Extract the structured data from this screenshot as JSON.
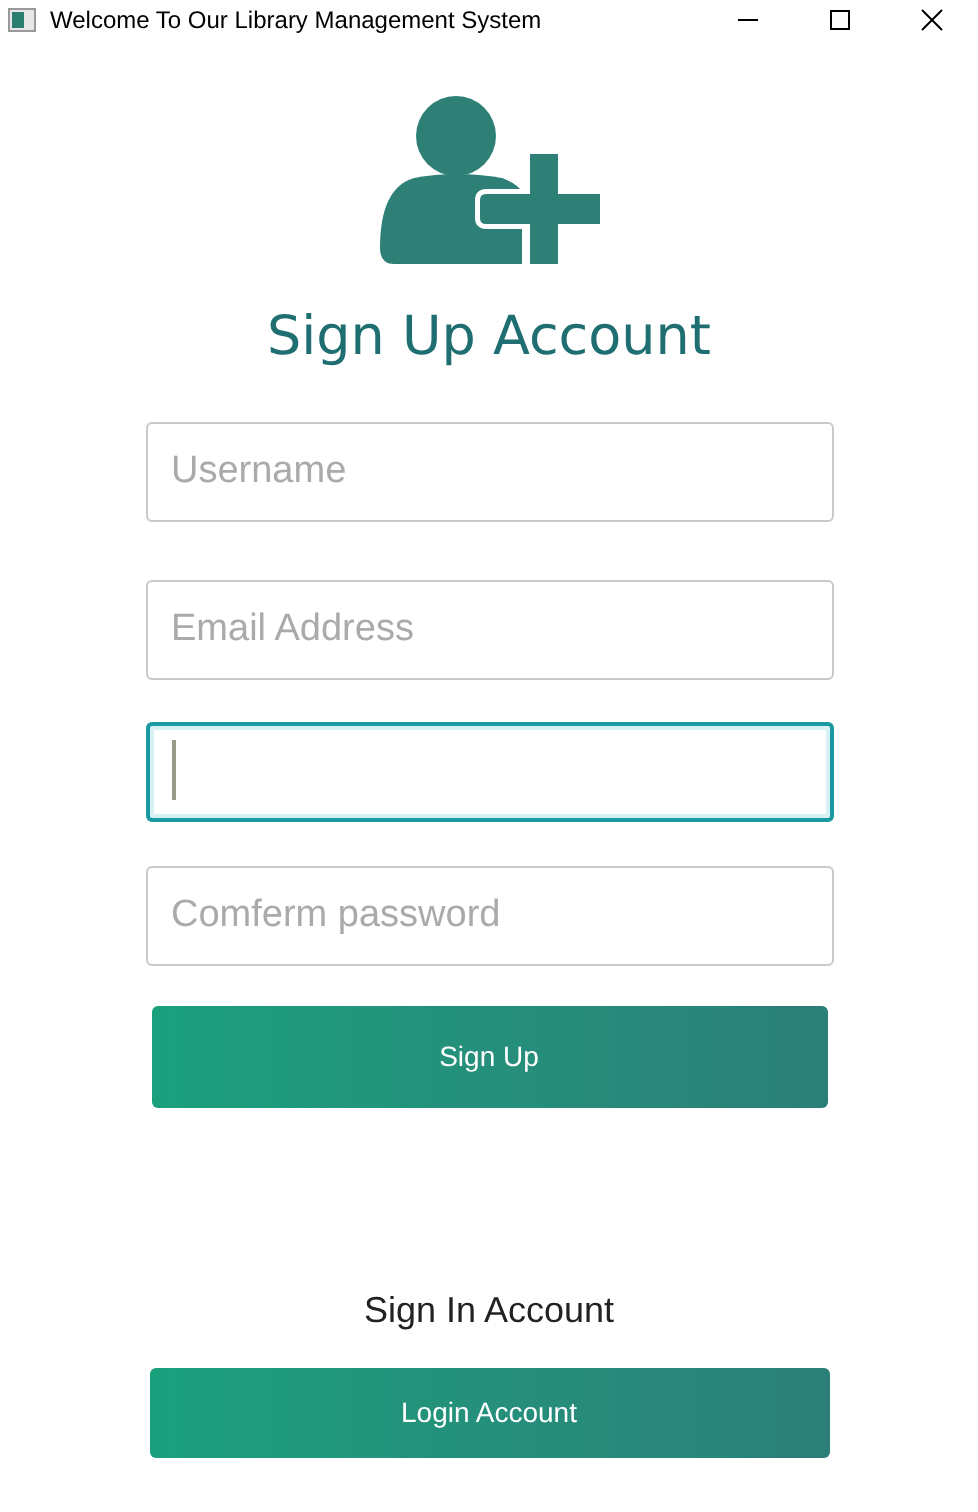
{
  "window": {
    "title": "Welcome To Our Library Management System"
  },
  "heading": "Sign Up Account",
  "fields": [
    {
      "placeholder": "Username",
      "focused": false
    },
    {
      "placeholder": "Email Address",
      "focused": false
    },
    {
      "focused": true
    },
    {
      "placeholder": "Comferm password",
      "focused": false
    }
  ],
  "signup_button": "Sign Up",
  "signin_label": "Sign In Account",
  "login_button": "Login Account"
}
